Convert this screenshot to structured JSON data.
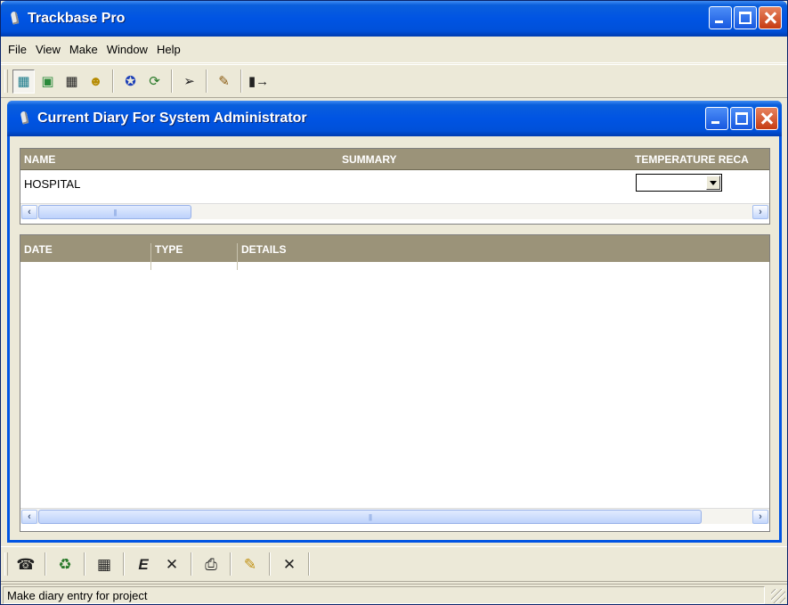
{
  "app": {
    "title": "Trackbase Pro",
    "menu": [
      "File",
      "View",
      "Make",
      "Window",
      "Help"
    ],
    "top_toolbar_icons": [
      "diary-icon",
      "project-icon",
      "calendar-icon",
      "contacts-icon",
      "run-icon",
      "refresh-icon",
      "pick-icon",
      "tools-icon",
      "exit-door-icon"
    ]
  },
  "child": {
    "title": "Current Diary For System Administrator"
  },
  "summary_grid": {
    "columns": [
      "NAME",
      "SUMMARY",
      "TEMPERATURE RECA"
    ],
    "rows": [
      {
        "name": "HOSPITAL",
        "summary": "",
        "temperature": ""
      }
    ]
  },
  "diary_grid": {
    "columns": [
      "DATE",
      "TYPE",
      "DETAILS"
    ],
    "rows": []
  },
  "bottom_toolbar_icons": [
    "phone-icon",
    "recycle-icon",
    "id-card-icon",
    "edit-entry-icon",
    "delete-icon",
    "print-icon",
    "eraser-icon",
    "close-icon"
  ],
  "status": {
    "text": "Make diary entry for project"
  },
  "colors": {
    "title_bar": "#0054e3",
    "grid_header": "#9b9379",
    "close_button": "#c63b13",
    "face": "#ece9d8"
  }
}
